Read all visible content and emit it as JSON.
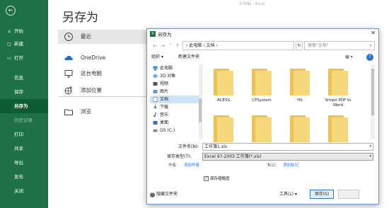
{
  "backstage": {
    "title": "另存为",
    "top_center": "工作簿1 - Excel",
    "nav": {
      "back_symbol": "←",
      "items": [
        {
          "label": "开始",
          "icon": "home-icon"
        },
        {
          "label": "新建",
          "icon": "new-file-icon"
        },
        {
          "label": "打开",
          "icon": "open-folder-icon"
        },
        {
          "label": "信息",
          "icon": ""
        },
        {
          "label": "保存",
          "icon": ""
        },
        {
          "label": "另存为",
          "icon": "",
          "active": true
        },
        {
          "label": "历史记录",
          "icon": "",
          "dim": true
        },
        {
          "label": "打印",
          "icon": ""
        },
        {
          "label": "共享",
          "icon": ""
        },
        {
          "label": "导出",
          "icon": ""
        },
        {
          "label": "发布",
          "icon": ""
        },
        {
          "label": "关闭",
          "icon": ""
        }
      ]
    },
    "locations": [
      {
        "label": "最近",
        "icon": "clock-icon",
        "selected": true
      },
      {
        "label": "OneDrive",
        "icon": "cloud-icon"
      },
      {
        "label": "这台电脑",
        "icon": "computer-icon"
      },
      {
        "label": "添加位置",
        "icon": "globe-plus-icon"
      },
      {
        "label": "浏览",
        "icon": "folder-icon"
      }
    ]
  },
  "dialog": {
    "title": "另存为",
    "close_symbol": "✕",
    "address_path": "›  此电脑  ›  文档  ›",
    "search_placeholder": "搜索\"文档\"",
    "toolbar": {
      "organize": "组织 ▾",
      "new_folder": "新建文件夹",
      "view": "▦ ▾",
      "help": "?"
    },
    "tree": [
      {
        "label": "此电脑",
        "icon": "computer-icon"
      },
      {
        "label": "3D 对象",
        "icon": "cube-icon"
      },
      {
        "label": "视频",
        "icon": "video-icon"
      },
      {
        "label": "图片",
        "icon": "picture-icon"
      },
      {
        "label": "文档",
        "icon": "document-icon",
        "selected": true
      },
      {
        "label": "下载",
        "icon": "download-icon"
      },
      {
        "label": "音乐",
        "icon": "music-icon"
      },
      {
        "label": "桌面",
        "icon": "desktop-icon"
      },
      {
        "label": "OS (C:)",
        "icon": "drive-icon"
      }
    ],
    "folders": [
      {
        "name": ""
      },
      {
        "name": ""
      },
      {
        "name": ""
      },
      {
        "name": ""
      },
      {
        "name": "ACESS"
      },
      {
        "name": "CFSystem"
      },
      {
        "name": "HS"
      },
      {
        "name": "Simpo PDF to Word"
      },
      {
        "name": ""
      },
      {
        "name": ""
      },
      {
        "name": ""
      },
      {
        "name": ""
      }
    ],
    "filename_label": "文件名(N):",
    "filename_value": "工作簿1.xls",
    "filetype_label": "保存类型(T):",
    "filetype_value": "Excel 97-2003 工作簿(*.xls)",
    "author_label": "作者:",
    "author_link": "添加作者",
    "tags_label": "标记:",
    "tags_link": "添加标记",
    "thumbnail_label": "保存缩略图",
    "hide_folders": "隐藏文件夹",
    "tools": "工具(L)  ▾",
    "save": "保存(S)",
    "cancel": ""
  }
}
